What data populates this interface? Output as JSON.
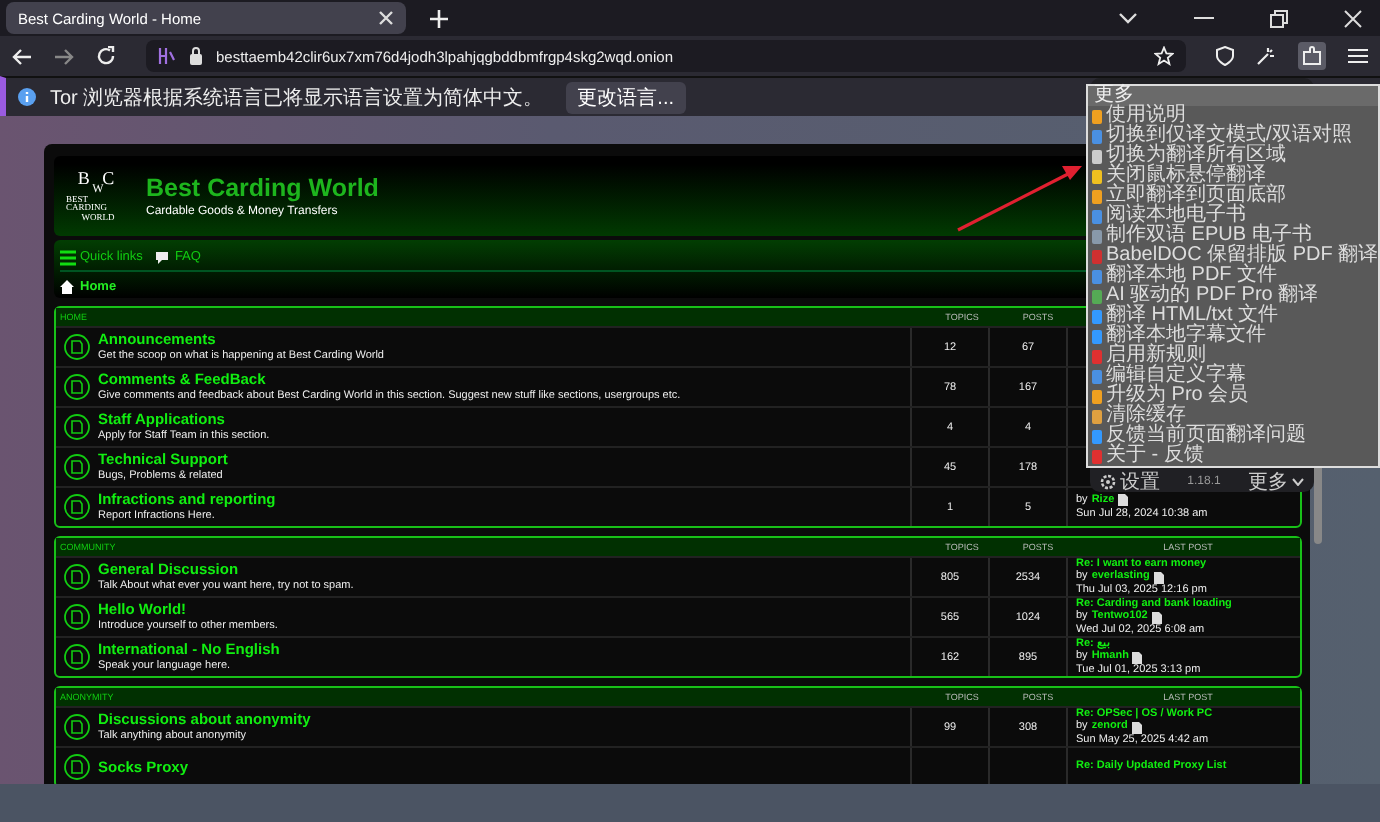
{
  "browser": {
    "tabs": [
      {
        "title": "Best Carding World - Home",
        "selected": true
      }
    ],
    "address": "besttaemb42clir6ux7xm76d4jodh3lpahjqgbddbmfrgp4skg2wqd.onion"
  },
  "notification": {
    "text": "Tor 浏览器根据系统语言已将显示语言设置为简体中文。",
    "button": "更改语言..."
  },
  "site": {
    "logo": {
      "top": "B C",
      "middle": "W",
      "bottom": "BEST CARDING",
      "bottom2": "WORLD"
    },
    "title": "Best Carding World",
    "tagline": "Cardable Goods & Money Transfers",
    "nav": [
      "Quick links",
      "FAQ"
    ],
    "breadcrumb": "Home"
  },
  "sections": [
    {
      "name": "HOME",
      "columns": [
        "TOPICS",
        "POSTS"
      ],
      "rows": [
        {
          "title": "Announcements",
          "description": "Get the scoop on what is happening at Best Carding World",
          "topics": "12",
          "posts": "67"
        },
        {
          "title": "Comments & FeedBack",
          "description": "Give comments and feedback about Best Carding World in this section. Suggest new stuff like sections, usergroups etc.",
          "topics": "78",
          "posts": "167"
        },
        {
          "title": "Staff Applications",
          "description": "Apply for Staff Team in this section.",
          "topics": "4",
          "posts": "4"
        },
        {
          "title": "Technical Support",
          "description": "Bugs, Problems & related",
          "topics": "45",
          "posts": "178"
        },
        {
          "title": "Infractions and reporting",
          "description": "Report Infractions Here.",
          "topics": "1",
          "posts": "5",
          "last_post": {
            "by": "by",
            "user": "Rize",
            "date": "Sun Jul 28, 2024 10:38 am"
          }
        }
      ]
    },
    {
      "name": "COMMUNITY",
      "columns": [
        "TOPICS",
        "POSTS",
        "LAST POST"
      ],
      "rows": [
        {
          "title": "General Discussion",
          "description": "Talk About what ever you want here, try not to spam.",
          "topics": "805",
          "posts": "2534",
          "last_post": {
            "title": "Re: I want to earn money",
            "by": "by",
            "user": "everlasting",
            "date": "Thu Jul 03, 2025 12:16 pm"
          }
        },
        {
          "title": "Hello World!",
          "description": "Introduce yourself to other members.",
          "topics": "565",
          "posts": "1024",
          "last_post": {
            "title": "Re: Carding and bank loading",
            "by": "by",
            "user": "Tentwo102",
            "date": "Wed Jul 02, 2025 6:08 am"
          }
        },
        {
          "title": "International - No English",
          "description": "Speak your language here.",
          "topics": "162",
          "posts": "895",
          "last_post": {
            "title": "Re: بيع",
            "by": "by",
            "user": "Hmanh",
            "date": "Tue Jul 01, 2025 3:13 pm"
          }
        }
      ]
    },
    {
      "name": "ANONYMITY",
      "columns": [
        "TOPICS",
        "POSTS",
        "LAST POST"
      ],
      "rows": [
        {
          "title": "Discussions about anonymity",
          "description": "Talk anything about anonymity",
          "topics": "99",
          "posts": "308",
          "last_post": {
            "title": "Re: OPSec | OS / Work PC",
            "by": "by",
            "user": "zenord",
            "date": "Sun May 25, 2025 4:42 am"
          }
        },
        {
          "title": "Socks Proxy",
          "description": "",
          "topics": "",
          "posts": "",
          "last_post": {
            "title": "Re: Daily Updated Proxy List"
          }
        }
      ]
    }
  ],
  "extension_panel": {
    "settings": "设置",
    "version": "1.18.1",
    "more": "更多"
  },
  "menu": {
    "header": "更多",
    "items": [
      {
        "label": "使用说明",
        "color": "#f0a020"
      },
      {
        "label": "切换到仅译文模式/双语对照",
        "color": "#4a90e2"
      },
      {
        "label": "切换为翻译所有区域",
        "color": "#cccccc"
      },
      {
        "label": "关闭鼠标悬停翻译",
        "color": "#f0c020"
      },
      {
        "label": "立即翻译到页面底部",
        "color": "#f0a020"
      },
      {
        "label": "阅读本地电子书",
        "color": "#4a90e2"
      },
      {
        "label": "制作双语 EPUB 电子书",
        "color": "#8899aa"
      },
      {
        "label": "BabelDOC 保留排版 PDF 翻译",
        "color": "#d03030"
      },
      {
        "label": "翻译本地 PDF 文件",
        "color": "#4a90e2"
      },
      {
        "label": "AI 驱动的 PDF Pro 翻译",
        "color": "#55aa55"
      },
      {
        "label": "翻译 HTML/txt 文件",
        "color": "#3399ff"
      },
      {
        "label": "翻译本地字幕文件",
        "color": "#3399ff"
      },
      {
        "label": "启用新规则",
        "color": "#e03030"
      },
      {
        "label": "编辑自定义字幕",
        "color": "#4a90e2"
      },
      {
        "label": "升级为 Pro 会员",
        "color": "#f0a020"
      },
      {
        "label": "清除缓存",
        "color": "#e0a040"
      },
      {
        "label": "反馈当前页面翻译问题",
        "color": "#3399ff"
      },
      {
        "label": "关于 - 反馈",
        "color": "#e03030"
      }
    ]
  }
}
